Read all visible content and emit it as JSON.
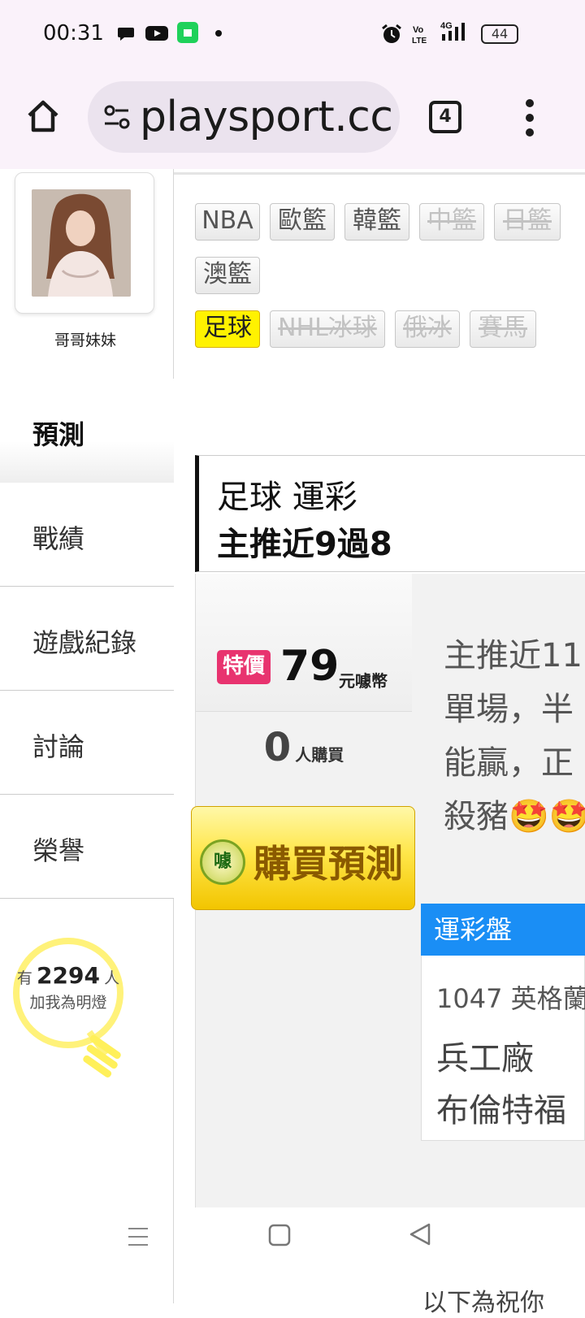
{
  "status_bar": {
    "time": "00:31",
    "icons": [
      "chat-bubble-icon",
      "youtube-icon",
      "line-app-icon",
      "dot-icon",
      "alarm-icon",
      "volte-icon",
      "signal-4g-icon"
    ],
    "battery": "44"
  },
  "browser": {
    "url": "playsport.cc",
    "tab_count": "4"
  },
  "sidebar": {
    "username": "哥哥妹妹",
    "items": [
      {
        "label": "預測",
        "active": true
      },
      {
        "label": "戰績",
        "active": false
      },
      {
        "label": "遊戲紀錄",
        "active": false
      },
      {
        "label": "討論",
        "active": false
      },
      {
        "label": "榮譽",
        "active": false
      }
    ],
    "fans": {
      "prefix": "有",
      "count": "2294",
      "suffix": "人",
      "line2": "加我為明燈"
    }
  },
  "categories": [
    {
      "label": "NBA",
      "state": "normal"
    },
    {
      "label": "歐籃",
      "state": "normal"
    },
    {
      "label": "韓籃",
      "state": "normal"
    },
    {
      "label": "中籃",
      "state": "disabled"
    },
    {
      "label": "日籃",
      "state": "disabled"
    },
    {
      "label": "澳籃",
      "state": "normal"
    },
    {
      "label": "足球",
      "state": "active"
    },
    {
      "label": "NHL冰球",
      "state": "disabled"
    },
    {
      "label": "俄冰",
      "state": "disabled"
    },
    {
      "label": "賽馬",
      "state": "disabled"
    }
  ],
  "prediction": {
    "title_line1": "足球 運彩",
    "title_line2": "主推近9過8",
    "tag": "特價",
    "price": "79",
    "currency": "元噱幣",
    "buyers_count": "0",
    "buyers_label": "人購買",
    "buy_button": "購買預測",
    "coin_glyph": "噱",
    "description": [
      "主推近11",
      "單場，半",
      "能贏，正",
      "殺豬🤩🤩"
    ]
  },
  "odds": {
    "header": "運彩盤",
    "game": "1047 英格蘭",
    "home": "兵工廠",
    "away": "布倫特福"
  },
  "bottom_text": "以下為祝你"
}
